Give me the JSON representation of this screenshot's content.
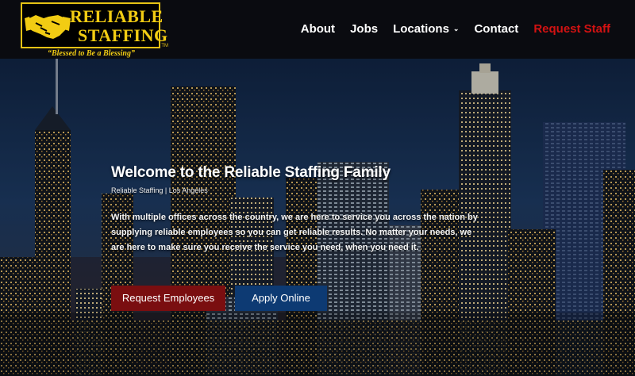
{
  "logo": {
    "line1": "RELIABLE",
    "line2": "STAFFING",
    "trademark": "TM",
    "tagline": "“Blessed to Be a Blessing”",
    "icon": "handshake-icon"
  },
  "nav": {
    "items": [
      {
        "label": "About"
      },
      {
        "label": "Jobs"
      },
      {
        "label": "Locations",
        "icon": "chevron-down-icon"
      },
      {
        "label": "Contact"
      },
      {
        "label": "Request Staff"
      }
    ]
  },
  "hero": {
    "title": "Welcome to the Reliable Staffing Family",
    "subtitle": "Reliable Staffing | Los Angeles",
    "body": "With multiple offices across the country, we are here to service you across the nation by supplying reliable employees so you can get reliable results.  No matter your needs, we are here to make sure you receive the service you need, when you need it.",
    "buttons": {
      "request": "Request Employees",
      "apply": "Apply Online"
    }
  },
  "colors": {
    "logo_gold": "#f2cc13",
    "header_bg": "#0a0b10",
    "request_staff_red": "#d21212",
    "request_button": "#7a0e10",
    "apply_button": "#0d3a73"
  }
}
